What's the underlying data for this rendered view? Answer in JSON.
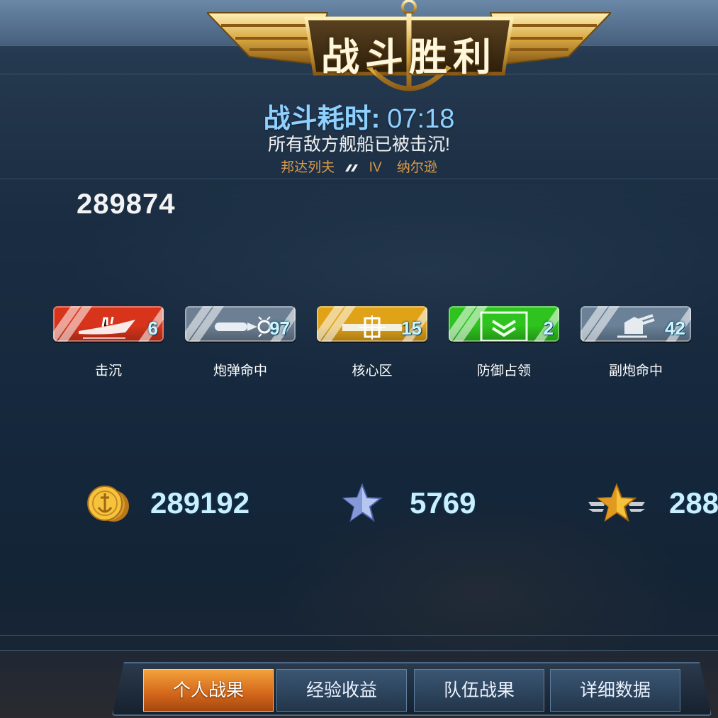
{
  "header": {
    "title": "战斗胜利",
    "time_label": "战斗耗时:",
    "time_value": "07:18",
    "result_message": "所有敌方舰船已被击沉!",
    "ship_left": "邦达列夫",
    "tier": "IV",
    "ship_right": "纳尔逊"
  },
  "score": "289874",
  "medals": [
    {
      "label": "击沉",
      "count": "6",
      "color": "#d8341c",
      "icon": "ship-sinking-icon"
    },
    {
      "label": "炮弹命中",
      "count": "97",
      "color": "#6c7f93",
      "icon": "shell-hit-icon"
    },
    {
      "label": "核心区",
      "count": "15",
      "color": "#e0a318",
      "icon": "citadel-icon"
    },
    {
      "label": "防御占领",
      "count": "2",
      "color": "#2ec31e",
      "icon": "capture-defense-icon"
    },
    {
      "label": "副炮命中",
      "count": "42",
      "color": "#6a8198",
      "icon": "secondary-gun-icon"
    }
  ],
  "rewards": [
    {
      "icon": "gold-coin-icon",
      "value": "289192"
    },
    {
      "icon": "blue-star-icon",
      "value": "5769"
    },
    {
      "icon": "gold-winged-star-icon",
      "value": "288"
    }
  ],
  "tabs": [
    {
      "label": "个人战果",
      "active": true
    },
    {
      "label": "经验收益",
      "active": false
    },
    {
      "label": "队伍战果",
      "active": false
    },
    {
      "label": "详细数据",
      "active": false
    }
  ]
}
